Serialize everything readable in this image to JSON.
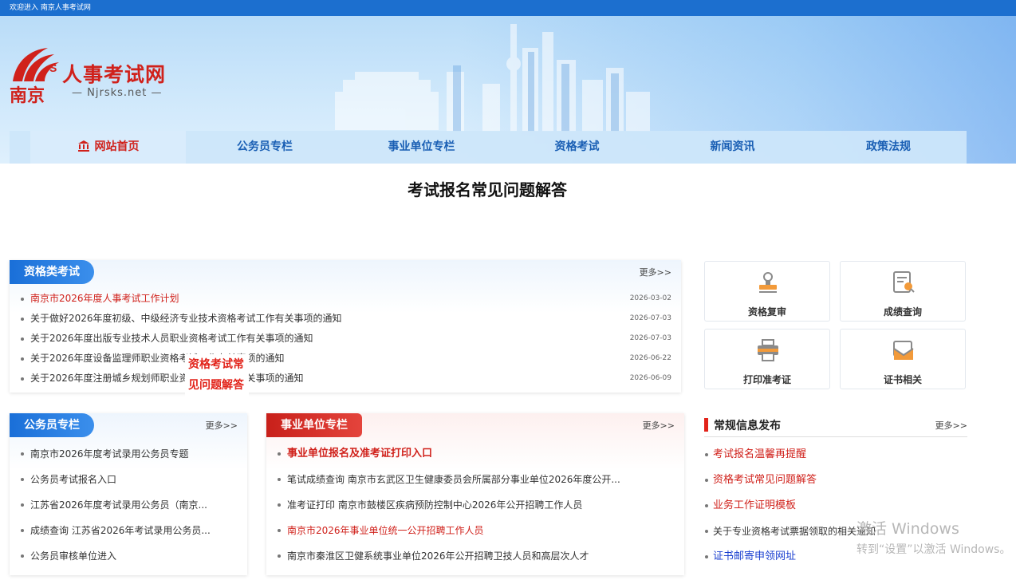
{
  "topbar": {
    "welcome": "欢迎进入 南京人事考试网"
  },
  "logo": {
    "title": "人事考试网",
    "subtitle": "— Njrsks.net —",
    "city": "南京",
    "mark": "S"
  },
  "nav": {
    "items": [
      {
        "label": "网站首页",
        "active": true
      },
      {
        "label": "公务员专栏"
      },
      {
        "label": "事业单位专栏"
      },
      {
        "label": "资格考试"
      },
      {
        "label": "新闻资讯"
      },
      {
        "label": "政策法规"
      }
    ]
  },
  "page_title": "考试报名常见问题解答",
  "qualification": {
    "title": "资格类考试",
    "more": "更多>>",
    "items": [
      {
        "text": "南京市2026年度人事考试工作计划",
        "date": "2026-03-02",
        "highlight": true
      },
      {
        "text": "关于做好2026年度初级、中级经济专业技术资格考试工作有关事项的通知",
        "date": "2026-07-03"
      },
      {
        "text": "关于2026年度出版专业技术人员职业资格考试工作有关事项的通知",
        "date": "2026-07-03"
      },
      {
        "text": "关于2026年度设备监理师职业资格考试工作有关事项的通知",
        "date": "2026-06-22"
      },
      {
        "text": "关于2026年度注册城乡规划师职业资格考试工作有关事项的通知",
        "date": "2026-06-09"
      }
    ]
  },
  "overlay": {
    "line1": "资格考试常",
    "line2": "见问题解答"
  },
  "quick_cards": [
    {
      "label": "资格复审",
      "icon": "stamp-icon"
    },
    {
      "label": "成绩查询",
      "icon": "search-document-icon"
    },
    {
      "label": "打印准考证",
      "icon": "printer-icon"
    },
    {
      "label": "证书相关",
      "icon": "certificate-envelope-icon"
    }
  ],
  "civil": {
    "title": "公务员专栏",
    "more": "更多>>",
    "items": [
      {
        "text": "南京市2026年度考试录用公务员专题"
      },
      {
        "text": "公务员考试报名入口"
      },
      {
        "text": "江苏省2026年度考试录用公务员（南京..."
      },
      {
        "text": "成绩查询 江苏省2026年考试录用公务员..."
      },
      {
        "text": "公务员审核单位进入"
      }
    ]
  },
  "institution": {
    "title": "事业单位专栏",
    "more": "更多>>",
    "items": [
      {
        "text": "事业单位报名及准考证打印入口",
        "highlight": true,
        "bold": true
      },
      {
        "text": "笔试成绩查询 南京市玄武区卫生健康委员会所属部分事业单位2026年度公开..."
      },
      {
        "text": "准考证打印 南京市鼓楼区疾病预防控制中心2026年公开招聘工作人员"
      },
      {
        "text": "南京市2026年事业单位统一公开招聘工作人员",
        "highlight": true
      },
      {
        "text": "南京市秦淮区卫健系统事业单位2026年公开招聘卫技人员和高层次人才"
      }
    ]
  },
  "notices": {
    "title": "常规信息发布",
    "more": "更多>>",
    "items": [
      {
        "text": "考试报名温馨再提醒",
        "color": "#d0211b"
      },
      {
        "text": "资格考试常见问题解答",
        "color": "#d0211b"
      },
      {
        "text": "业务工作证明模板",
        "color": "#d0211b"
      },
      {
        "text": "关于专业资格考试票据领取的相关通知",
        "color": "#333333"
      },
      {
        "text": "证书邮寄申领网址",
        "color": "#1a3fd0"
      }
    ]
  },
  "watermark": {
    "line1": "激活 Windows",
    "line2": "转到“设置”以激活 Windows。"
  },
  "colors": {
    "brand_red": "#d0211b",
    "brand_blue": "#1c6fcf"
  }
}
